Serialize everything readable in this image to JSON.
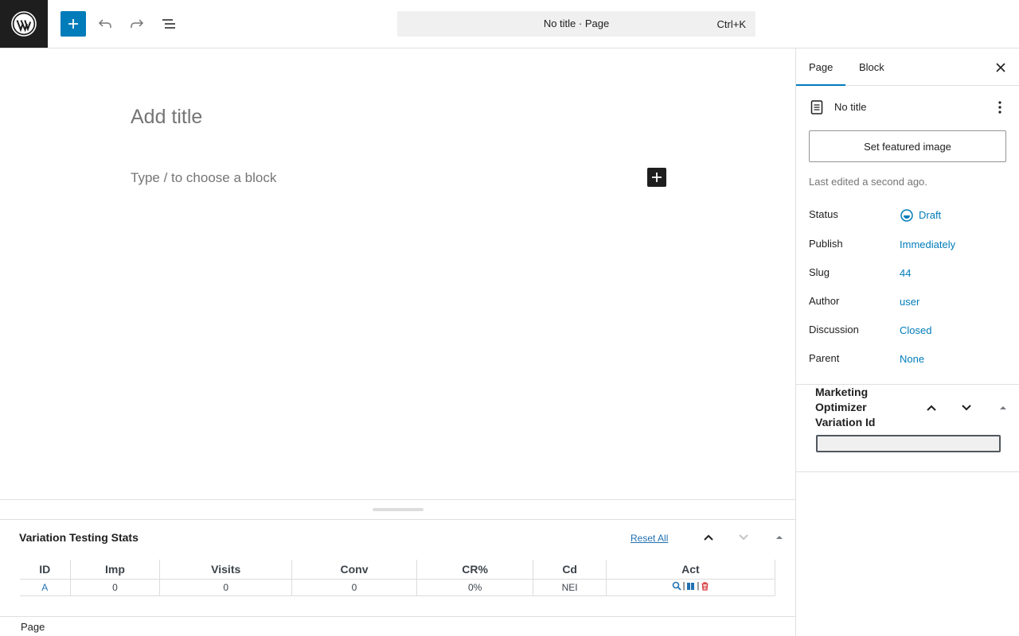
{
  "topbar": {
    "command_title": "No title · Page",
    "command_shortcut": "Ctrl+K"
  },
  "canvas": {
    "title_placeholder": "Add title",
    "block_placeholder": "Type / to choose a block"
  },
  "bottom_metabox": {
    "title": "Variation Testing Stats",
    "reset_label": "Reset All",
    "columns": [
      "ID",
      "Imp",
      "Visits",
      "Conv",
      "CR%",
      "Cd",
      "Act"
    ],
    "rows": [
      {
        "id": "A",
        "imp": "0",
        "visits": "0",
        "conv": "0",
        "cr": "0%",
        "cd": "NEI",
        "act_sep1": "|",
        "act_sep2": "|"
      }
    ]
  },
  "footer": {
    "breadcrumb": "Page"
  },
  "sidebar": {
    "tabs": [
      {
        "label": "Page"
      },
      {
        "label": "Block"
      }
    ],
    "document_title": "No title",
    "featured_image_label": "Set featured image",
    "last_edited": "Last edited a second ago.",
    "properties": [
      {
        "label": "Status",
        "value": "Draft"
      },
      {
        "label": "Publish",
        "value": "Immediately"
      },
      {
        "label": "Slug",
        "value": "44"
      },
      {
        "label": "Author",
        "value": "user"
      },
      {
        "label": "Discussion",
        "value": "Closed"
      },
      {
        "label": "Parent",
        "value": "None"
      }
    ],
    "metabox_title": "Marketing Optimizer Variation Id",
    "metabox_input_value": ""
  },
  "colors": {
    "accent": "#007cba",
    "dark": "#1e1e1e",
    "link": "#2271b1",
    "delete": "#d63638"
  }
}
